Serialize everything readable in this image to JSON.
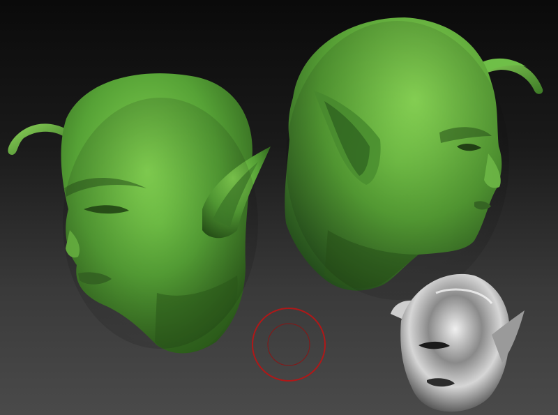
{
  "scene": {
    "background_top": "#0a0a0a",
    "background_bottom": "#4a4a4a",
    "skin_light": "#7ccc4c",
    "skin_mid": "#4f9a32",
    "skin_dark": "#244f16",
    "chrome_light": "#e8e8e8",
    "chrome_dark": "#2a2a2a",
    "brush_ring_color": "#b01818"
  },
  "objects": [
    {
      "name": "green-alien-head-three-quarter"
    },
    {
      "name": "green-alien-head-profile"
    },
    {
      "name": "chrome-alien-head-thumbnail"
    },
    {
      "name": "brush-cursor-ring"
    }
  ]
}
